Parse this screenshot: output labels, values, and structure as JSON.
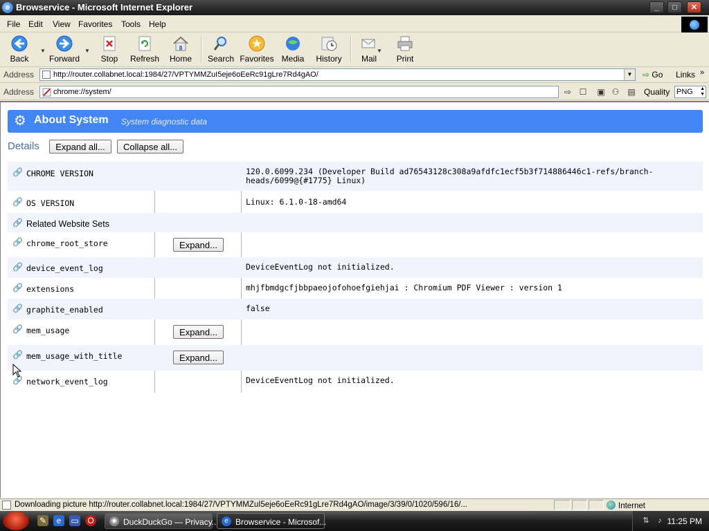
{
  "window": {
    "title": "Browservice - Microsoft Internet Explorer",
    "minimize_glyph": "_",
    "maximize_glyph": "□",
    "close_glyph": "✕"
  },
  "menu": {
    "items": [
      {
        "label": "File"
      },
      {
        "label": "Edit"
      },
      {
        "label": "View"
      },
      {
        "label": "Favorites"
      },
      {
        "label": "Tools"
      },
      {
        "label": "Help"
      }
    ]
  },
  "toolbar": {
    "back": "Back",
    "forward": "Forward",
    "stop": "Stop",
    "refresh": "Refresh",
    "home": "Home",
    "search": "Search",
    "favorites": "Favorites",
    "media": "Media",
    "history": "History",
    "mail": "Mail",
    "print": "Print"
  },
  "address": {
    "label": "Address",
    "url": "http://router.collabnet.local:1984/27/VPTYMMZuI5eje6oEeRc91gLre7Rd4gAO/",
    "go": "Go",
    "links": "Links"
  },
  "inner_address": {
    "label": "Address",
    "url": "chrome://system/",
    "quality_label": "Quality",
    "quality_value": "PNG"
  },
  "page": {
    "title": "About System",
    "subtitle": "System diagnostic data",
    "details_label": "Details",
    "expand_all": "Expand all...",
    "collapse_all": "Collapse all...",
    "rows": [
      {
        "key": "CHROME VERSION",
        "value": "120.0.6099.234 (Developer Build ad76543128c308a9afdfc1ecf5b3f714886446c1-refs/branch-heads/6099@{#1775} Linux)",
        "button": ""
      },
      {
        "key": "OS VERSION",
        "value": "Linux: 6.1.0-18-amd64",
        "button": ""
      },
      {
        "key": "Related Website Sets",
        "value": "",
        "button": ""
      },
      {
        "key": "chrome_root_store",
        "value": "",
        "button": "Expand..."
      },
      {
        "key": "device_event_log",
        "value": "DeviceEventLog not initialized.",
        "button": ""
      },
      {
        "key": "extensions",
        "value": "mhjfbmdgcfjbbpaeojofohoefgiehjai : Chromium PDF Viewer : version 1",
        "button": ""
      },
      {
        "key": "graphite_enabled",
        "value": "false",
        "button": ""
      },
      {
        "key": "mem_usage",
        "value": "",
        "button": "Expand..."
      },
      {
        "key": "mem_usage_with_title",
        "value": "",
        "button": "Expand..."
      },
      {
        "key": "network_event_log",
        "value": "DeviceEventLog not initialized.",
        "button": ""
      }
    ]
  },
  "status": {
    "text": "Downloading picture http://router.collabnet.local:1984/27/VPTYMMZuI5eje6oEeRc91gLre7Rd4gAO/image/3/39/0/1020/596/16/...",
    "zone": "Internet"
  },
  "taskbar": {
    "tasks": [
      {
        "label": "DuckDuckGo — Privacy..."
      },
      {
        "label": "Browservice - Microsof..."
      }
    ],
    "clock": "11:25 PM"
  },
  "colors": {
    "banner": "#4285f4",
    "row_alt": "#f1f4fd"
  }
}
